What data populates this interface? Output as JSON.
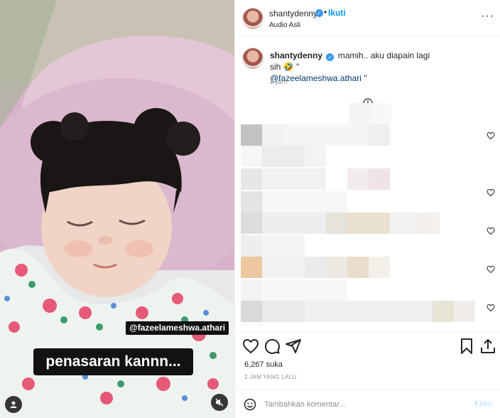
{
  "media": {
    "mention_tag": "@fazeelameshwa.athari",
    "video_caption": "penasaran kannn..."
  },
  "header": {
    "username": "shantydenny",
    "follow_label": "Ikuti",
    "audio_label": "Audio Asli"
  },
  "caption": {
    "username": "shantydenny",
    "text": "mamih.. aku diapain lagi sih 🤣 \"",
    "mention": "@fazeelameshwa.athari",
    "suffix": " \"",
    "time": "2 jam"
  },
  "engagement": {
    "likes": "6,267 suka",
    "posted": "2 JAM YANG LALU"
  },
  "comment": {
    "placeholder": "Tambahkan komentar...",
    "post_label": "Kirim"
  },
  "colors": {
    "accent": "#0095f6",
    "verified": "#3897f0",
    "post_disabled": "#b2dffc"
  },
  "icons": [
    "verified-icon",
    "more-icon",
    "heart-icon",
    "comment-icon",
    "share-icon",
    "save-icon",
    "upload-icon",
    "emoji-icon",
    "mute-icon",
    "user-icon"
  ]
}
